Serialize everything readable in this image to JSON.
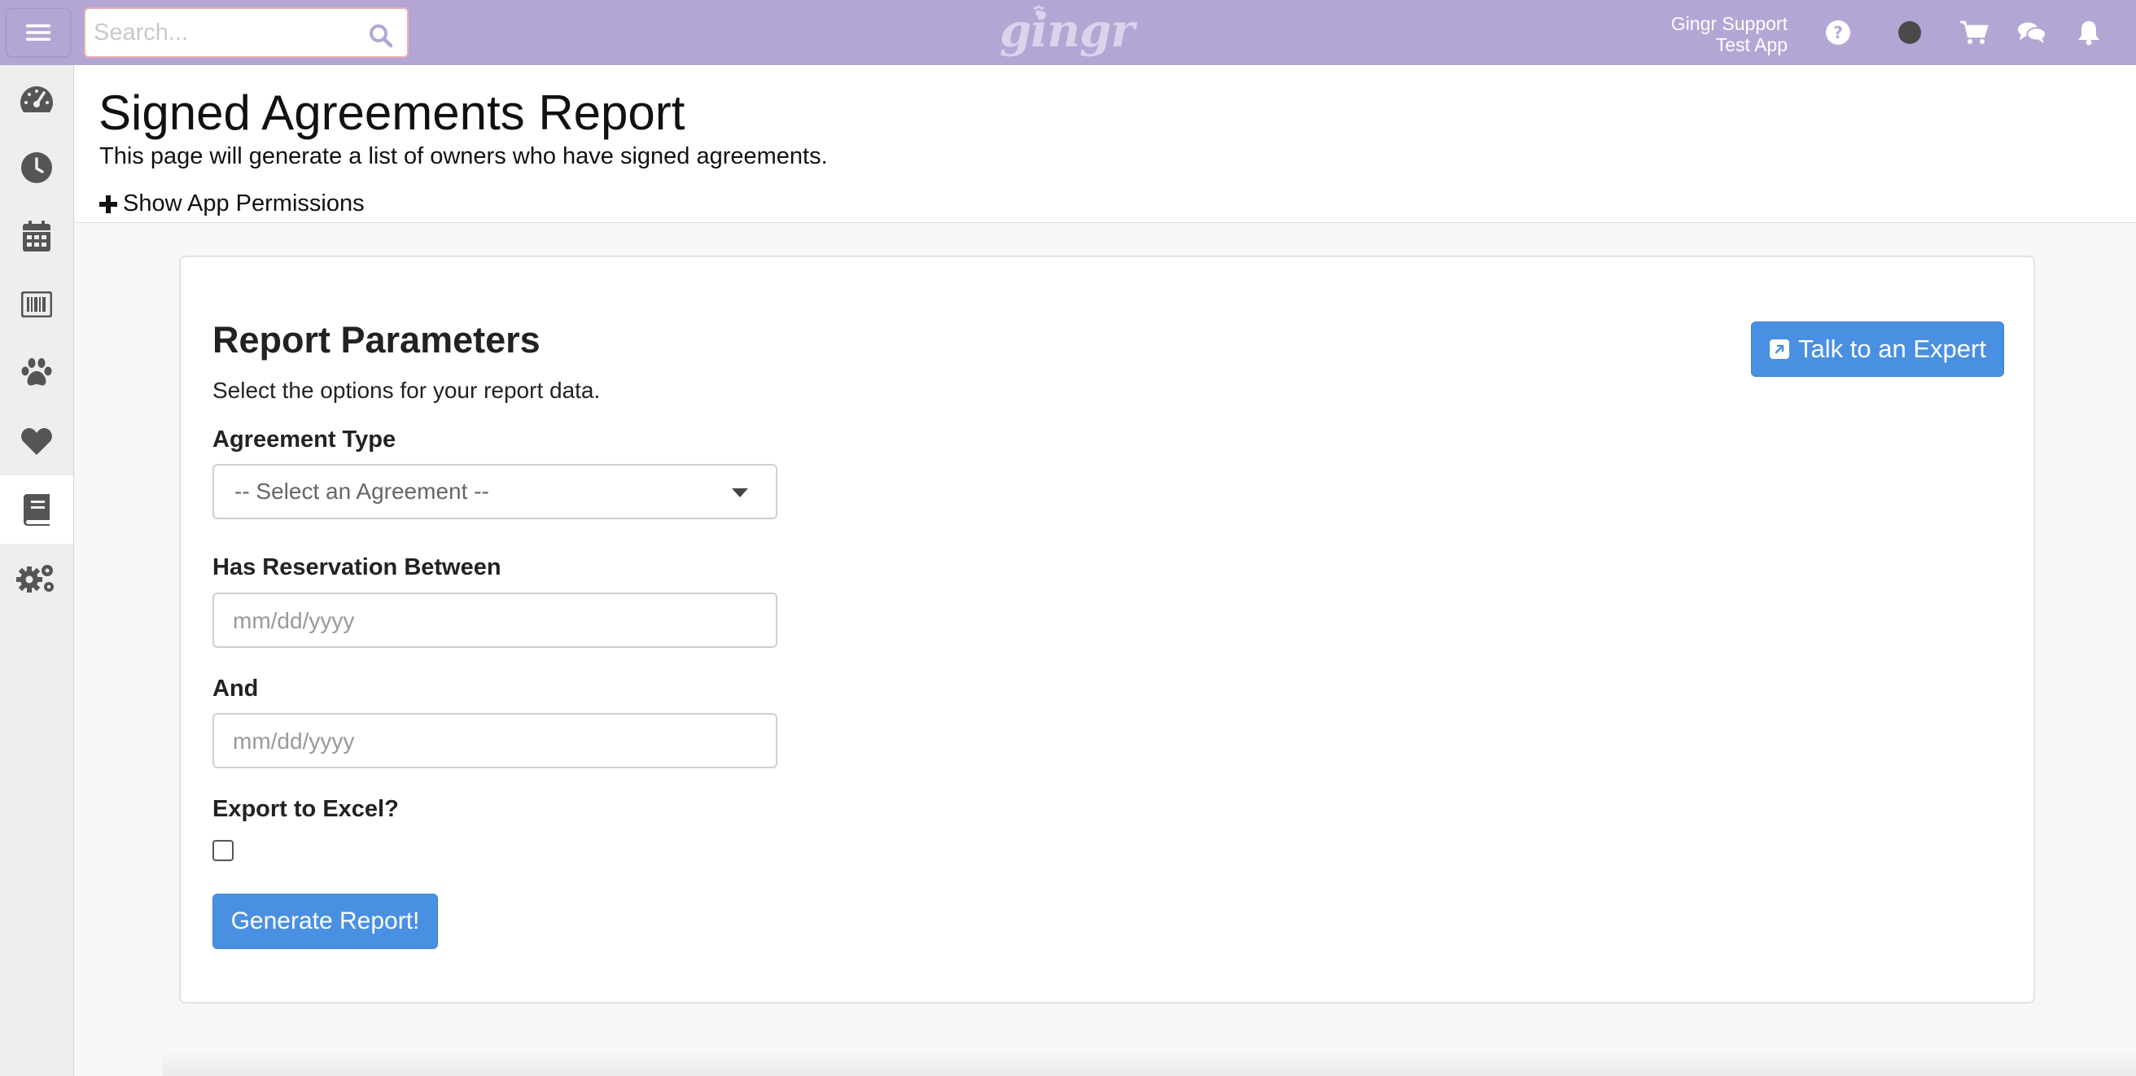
{
  "topbar": {
    "search_placeholder": "Search...",
    "logo_text": "gingr",
    "user_name": "Gingr Support",
    "app_name": "Test App",
    "icons": [
      "menu-icon",
      "search-icon",
      "help-icon",
      "status-dot-icon",
      "cart-icon",
      "chat-icon",
      "bell-icon"
    ],
    "color": "#b3a6d4"
  },
  "sidebar": {
    "items": [
      {
        "icon": "dashboard-icon",
        "active": false
      },
      {
        "icon": "clock-icon",
        "active": false
      },
      {
        "icon": "calendar-icon",
        "active": false
      },
      {
        "icon": "barcode-icon",
        "active": false
      },
      {
        "icon": "paw-icon",
        "active": false
      },
      {
        "icon": "heart-icon",
        "active": false
      },
      {
        "icon": "book-icon",
        "active": true
      },
      {
        "icon": "gears-icon",
        "active": false
      }
    ]
  },
  "header": {
    "title": "Signed Agreements Report",
    "subtitle": "This page will generate a list of owners who have signed agreements.",
    "permissions_label": "Show App Permissions"
  },
  "card": {
    "title": "Report Parameters",
    "subtitle": "Select the options for your report data.",
    "expert_button": "Talk to an Expert",
    "agreement_label": "Agreement Type",
    "agreement_selected": "-- Select an Agreement --",
    "reservation_label": "Has Reservation Between",
    "date_placeholder": "mm/dd/yyyy",
    "and_label": "And",
    "export_label": "Export to Excel?",
    "export_checked": false,
    "generate_button": "Generate Report!",
    "accent_color": "#4a90e2"
  }
}
